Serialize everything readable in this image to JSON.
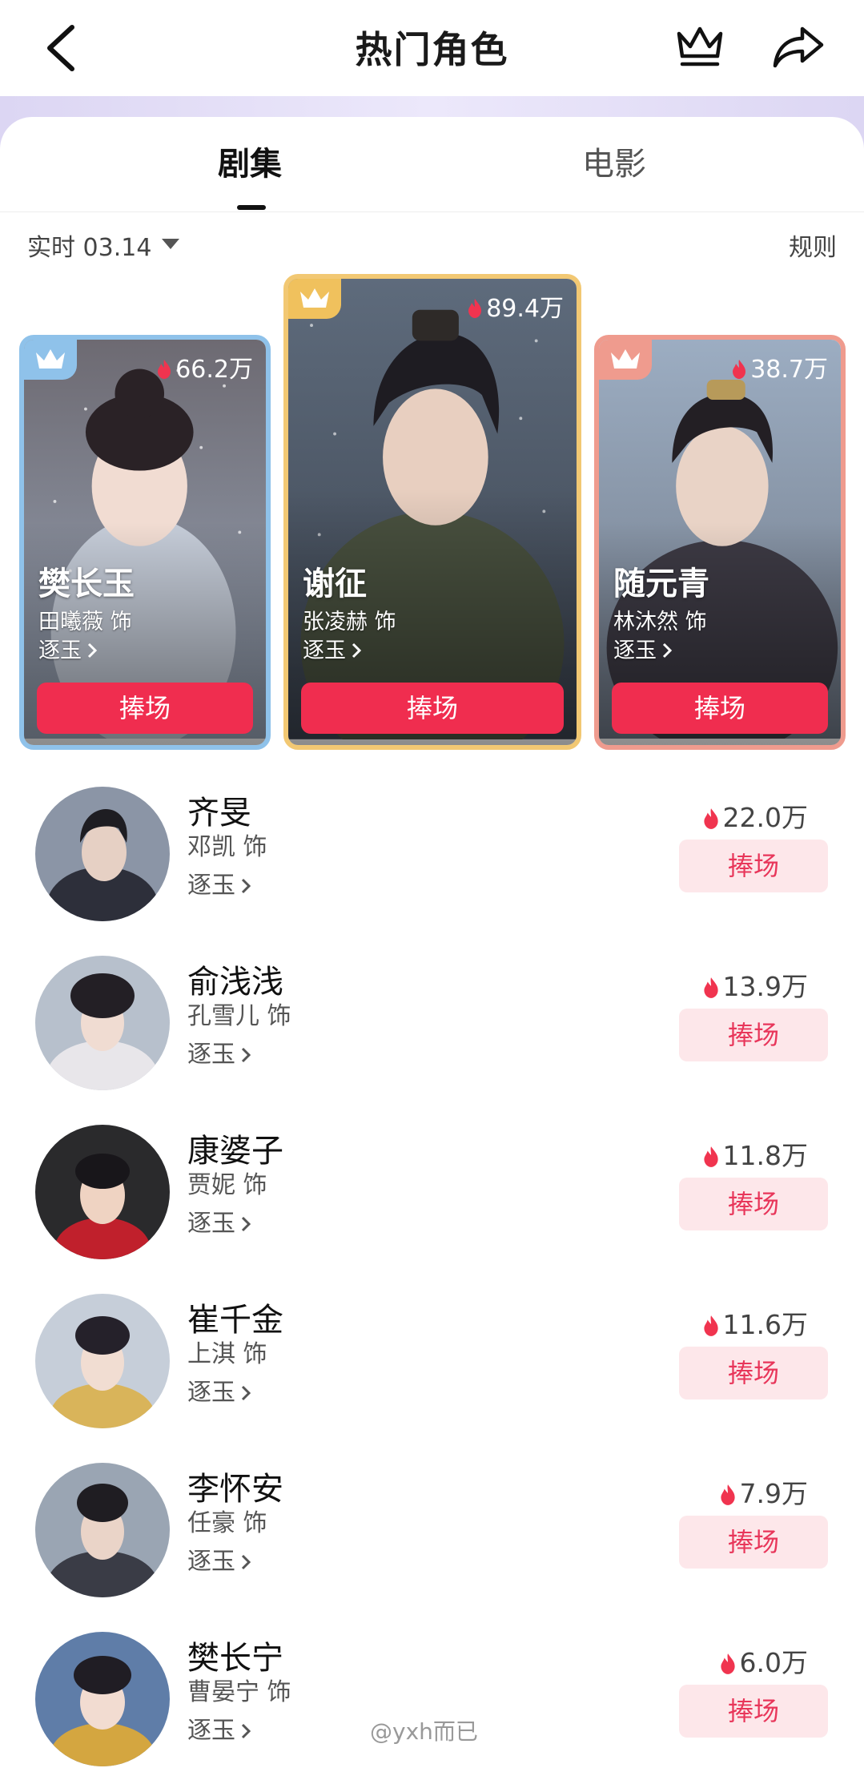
{
  "header": {
    "title": "热门角色",
    "back_icon": "chevron-left-icon",
    "crown_icon": "crown-icon",
    "share_icon": "share-arrow-icon"
  },
  "tabs": [
    {
      "label": "剧集",
      "active": true
    },
    {
      "label": "电影",
      "active": false
    }
  ],
  "filter": {
    "label": "实时 03.14",
    "rules": "规则"
  },
  "top_cards": [
    {
      "rank": 2,
      "heat": "66.2万",
      "character": "樊长玉",
      "actor": "田曦薇 饰",
      "show": "逐玉",
      "cheer": "捧场",
      "frame_color": "#8fc2ea",
      "badge_color": "#8fc2ea"
    },
    {
      "rank": 1,
      "heat": "89.4万",
      "character": "谢征",
      "actor": "张凌赫 饰",
      "show": "逐玉",
      "cheer": "捧场",
      "frame_color": "#f2c873",
      "badge_color": "#f0c15d"
    },
    {
      "rank": 3,
      "heat": "38.7万",
      "character": "随元青",
      "actor": "林沐然 饰",
      "show": "逐玉",
      "cheer": "捧场",
      "frame_color": "#ef9b8e",
      "badge_color": "#ef9b8e"
    }
  ],
  "list": [
    {
      "character": "齐旻",
      "actor": "邓凯 饰",
      "show": "逐玉",
      "heat": "22.0万",
      "cheer": "捧场"
    },
    {
      "character": "俞浅浅",
      "actor": "孔雪儿 饰",
      "show": "逐玉",
      "heat": "13.9万",
      "cheer": "捧场"
    },
    {
      "character": "康婆子",
      "actor": "贾妮 饰",
      "show": "逐玉",
      "heat": "11.8万",
      "cheer": "捧场"
    },
    {
      "character": "崔千金",
      "actor": "上淇 饰",
      "show": "逐玉",
      "heat": "11.6万",
      "cheer": "捧场"
    },
    {
      "character": "李怀安",
      "actor": "任豪 饰",
      "show": "逐玉",
      "heat": "7.9万",
      "cheer": "捧场"
    },
    {
      "character": "樊长宁",
      "actor": "曹晏宁 饰",
      "show": "逐玉",
      "heat": "6.0万",
      "cheer": "捧场"
    }
  ],
  "watermark": "@yxh而已",
  "colors": {
    "accent": "#f02d4f",
    "cheer_light_bg": "#fde7ea",
    "cheer_light_text": "#e8365a",
    "flame": "#f0344f"
  }
}
